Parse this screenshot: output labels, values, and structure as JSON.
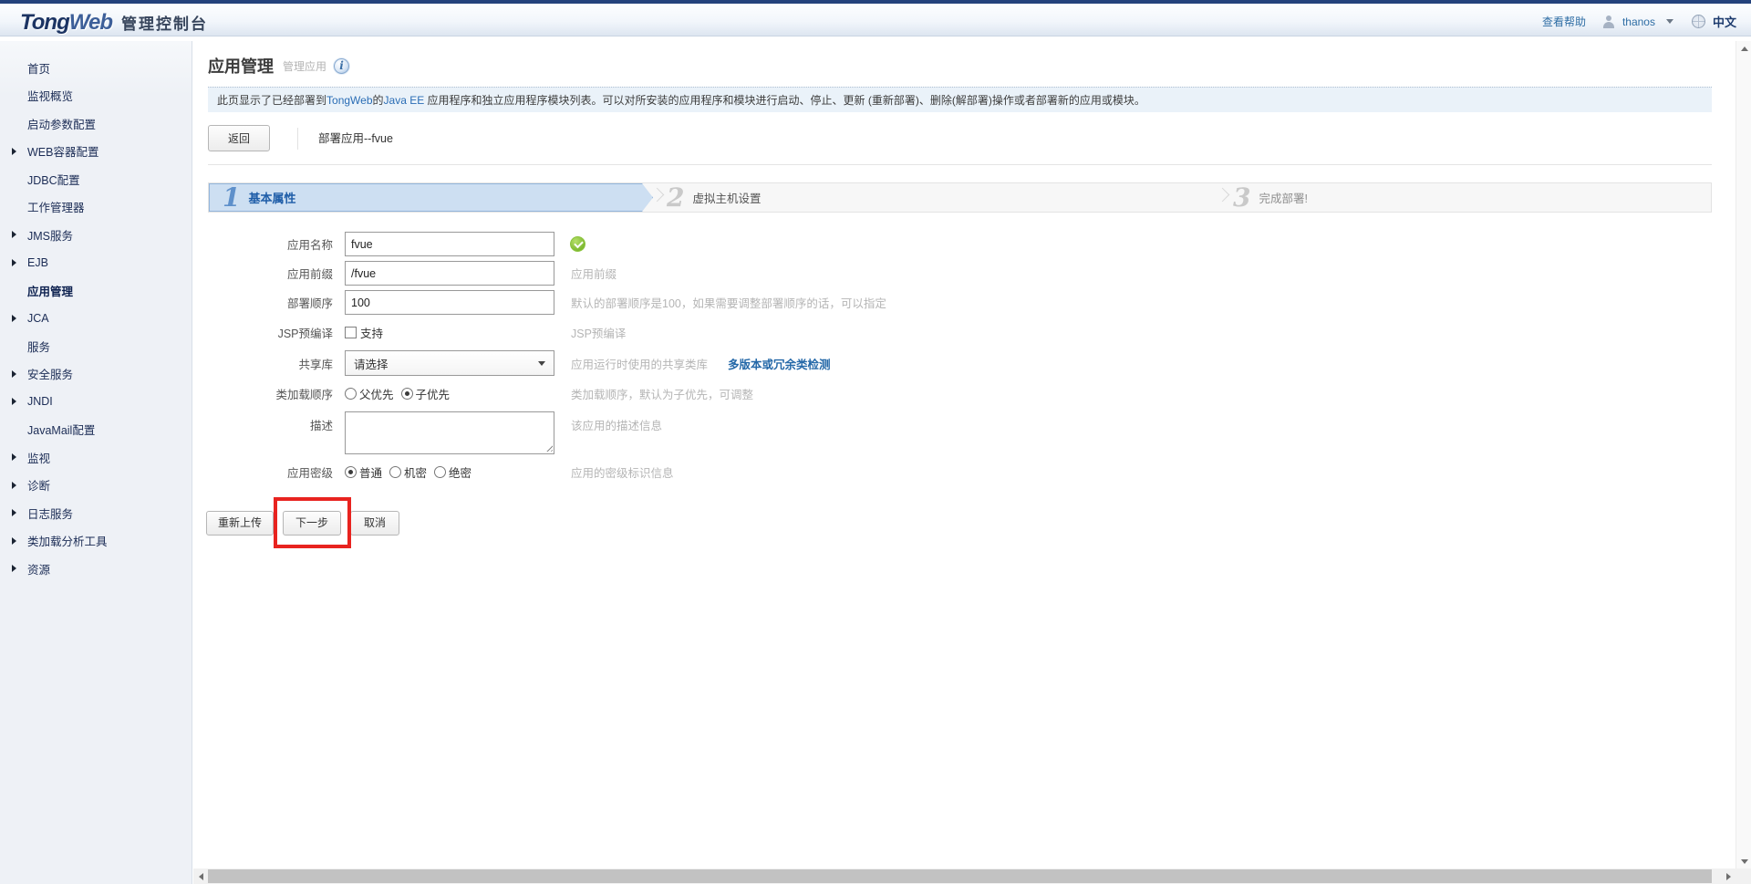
{
  "header": {
    "logo_tong": "Tong",
    "logo_web": "Web",
    "logo_title": "管理控制台",
    "help_link": "查看帮助",
    "username": "thanos",
    "language": "中文"
  },
  "sidebar": {
    "items": [
      {
        "label": "首页",
        "expandable": false,
        "active": false
      },
      {
        "label": "监视概览",
        "expandable": false,
        "active": false
      },
      {
        "label": "启动参数配置",
        "expandable": false,
        "active": false
      },
      {
        "label": "WEB容器配置",
        "expandable": true,
        "active": false
      },
      {
        "label": "JDBC配置",
        "expandable": false,
        "active": false
      },
      {
        "label": "工作管理器",
        "expandable": false,
        "active": false
      },
      {
        "label": "JMS服务",
        "expandable": true,
        "active": false
      },
      {
        "label": "EJB",
        "expandable": true,
        "active": false
      },
      {
        "label": "应用管理",
        "expandable": false,
        "active": true
      },
      {
        "label": "JCA",
        "expandable": true,
        "active": false
      },
      {
        "label": "服务",
        "expandable": false,
        "active": false
      },
      {
        "label": "安全服务",
        "expandable": true,
        "active": false
      },
      {
        "label": "JNDI",
        "expandable": true,
        "active": false
      },
      {
        "label": "JavaMail配置",
        "expandable": false,
        "active": false
      },
      {
        "label": "监视",
        "expandable": true,
        "active": false
      },
      {
        "label": "诊断",
        "expandable": true,
        "active": false
      },
      {
        "label": "日志服务",
        "expandable": true,
        "active": false
      },
      {
        "label": "类加载分析工具",
        "expandable": true,
        "active": false
      },
      {
        "label": "资源",
        "expandable": true,
        "active": false
      }
    ]
  },
  "page": {
    "title": "应用管理",
    "subtitle": "管理应用"
  },
  "notice": {
    "pre": "此页显示了已经部署到",
    "brand": "TongWeb",
    "mid": "的",
    "java": "Java EE",
    "post": " 应用程序和独立应用程序模块列表。可以对所安装的应用程序和模块进行启动、停止、更新 (重新部署)、删除(解部署)操作或者部署新的应用或模块。"
  },
  "toolbar": {
    "back_label": "返回",
    "deploy_title": "部署应用--fvue"
  },
  "wizard": {
    "steps": [
      {
        "num": "1",
        "label": "基本属性"
      },
      {
        "num": "2",
        "label": "虚拟主机设置"
      },
      {
        "num": "3",
        "label": "完成部署!"
      }
    ]
  },
  "form": {
    "app_name": {
      "label": "应用名称",
      "value": "fvue"
    },
    "app_prefix": {
      "label": "应用前缀",
      "value": "/fvue",
      "hint": "应用前缀"
    },
    "deploy_order": {
      "label": "部署顺序",
      "value": "100",
      "hint": "默认的部署顺序是100，如果需要调整部署顺序的话，可以指定"
    },
    "jsp_precompile": {
      "label": "JSP预编译",
      "checkbox_label": "支持",
      "checked": false,
      "hint": "JSP预编译"
    },
    "shared_lib": {
      "label": "共享库",
      "value": "请选择",
      "hint": "应用运行时使用的共享类库",
      "link": "多版本或冗余类检测"
    },
    "class_load_order": {
      "label": "类加载顺序",
      "options": [
        "父优先",
        "子优先"
      ],
      "selected": "子优先",
      "hint": "类加载顺序，默认为子优先，可调整"
    },
    "description": {
      "label": "描述",
      "value": "",
      "hint": "该应用的描述信息"
    },
    "security_level": {
      "label": "应用密级",
      "options": [
        "普通",
        "机密",
        "绝密"
      ],
      "selected": "普通",
      "hint": "应用的密级标识信息"
    }
  },
  "actions": {
    "reupload": "重新上传",
    "next": "下一步",
    "cancel": "取消"
  },
  "colors": {
    "accent_blue": "#2a6db5",
    "step_active_bg": "#cddff2",
    "highlight_red": "#e8231f",
    "check_green": "#7fb932",
    "sidebar_text": "#1b2c55"
  }
}
